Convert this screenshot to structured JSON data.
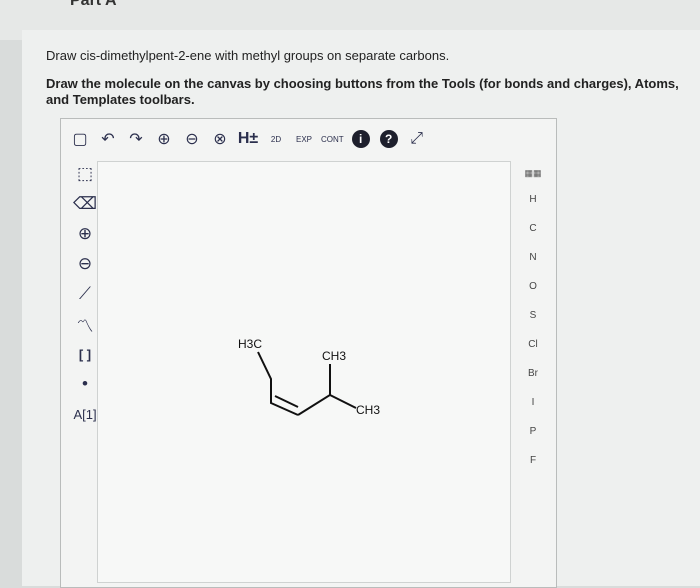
{
  "question": {
    "line1": "Draw cis-dimethylpent-2-ene with methyl groups on separate carbons.",
    "line2": "Draw the molecule on the canvas by choosing buttons from the Tools (for bonds and charges), Atoms, and Templates toolbars."
  },
  "top_toolbar": {
    "new": "new-icon",
    "undo": "undo-icon",
    "redo": "redo-icon",
    "zoom_in": "zoom-in-icon",
    "zoom_out": "zoom-out-icon",
    "zoom_reset": "zoom-reset-icon",
    "h_toggle": "H±",
    "two_d": "2D",
    "exp": "EXP",
    "cont": "CONT",
    "info_badge": "i",
    "help_badge": "?",
    "expand": "expand-icon"
  },
  "left_toolbar": [
    {
      "name": "select-tool",
      "glyph": "⬚"
    },
    {
      "name": "eraser-tool",
      "glyph": "⌫"
    },
    {
      "name": "positive-charge",
      "glyph": "⊕"
    },
    {
      "name": "negative-charge",
      "glyph": "⊖"
    },
    {
      "name": "bond-tool",
      "glyph": "⟋"
    },
    {
      "name": "chain-tool",
      "glyph": "〽"
    },
    {
      "name": "bracket-tool",
      "glyph": "[ ]"
    },
    {
      "name": "radical-tool",
      "glyph": "•"
    },
    {
      "name": "atom-map-tool",
      "glyph": "A[1]"
    }
  ],
  "molecule_labels": {
    "h3c": "H3C",
    "ch3_top": "CH3",
    "ch3_right": "CH3"
  },
  "atoms": [
    "H",
    "C",
    "N",
    "O",
    "S",
    "Cl",
    "Br",
    "I",
    "P",
    "F"
  ],
  "periodic_table": "periodic-table-icon"
}
